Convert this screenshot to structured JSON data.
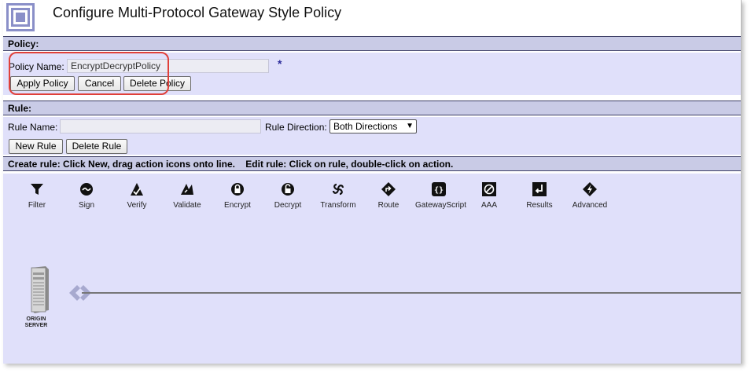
{
  "page": {
    "title": "Configure Multi-Protocol Gateway Style Policy"
  },
  "policy": {
    "header": "Policy:",
    "name_label": "Policy Name:",
    "name_value": "EncryptDecryptPolicy",
    "required_marker": "*",
    "buttons": {
      "apply": "Apply Policy",
      "cancel": "Cancel",
      "delete": "Delete Policy"
    }
  },
  "rule": {
    "header": "Rule:",
    "name_label": "Rule Name:",
    "name_value": "",
    "direction_label": "Rule Direction:",
    "direction_value": "Both Directions",
    "buttons": {
      "new": "New Rule",
      "delete": "Delete Rule"
    }
  },
  "instructions": "Create rule: Click New, drag action icons onto line.    Edit rule: Click on rule, double-click on action.",
  "actions": [
    {
      "label": "Filter",
      "icon": "filter-icon"
    },
    {
      "label": "Sign",
      "icon": "sign-icon"
    },
    {
      "label": "Verify",
      "icon": "verify-icon"
    },
    {
      "label": "Validate",
      "icon": "validate-icon"
    },
    {
      "label": "Encrypt",
      "icon": "encrypt-icon"
    },
    {
      "label": "Decrypt",
      "icon": "decrypt-icon"
    },
    {
      "label": "Transform",
      "icon": "transform-icon"
    },
    {
      "label": "Route",
      "icon": "route-icon"
    },
    {
      "label": "GatewayScript",
      "icon": "gatewayscript-icon"
    },
    {
      "label": "AAA",
      "icon": "aaa-icon"
    },
    {
      "label": "Results",
      "icon": "results-icon"
    },
    {
      "label": "Advanced",
      "icon": "advanced-icon"
    }
  ],
  "server": {
    "label_line1": "ORIGIN",
    "label_line2": "SERVER",
    "icon": "server-icon"
  },
  "colors": {
    "section_bg": "#e0e0fa",
    "header_bg": "#c9cbe6",
    "highlight": "#e0403a"
  }
}
